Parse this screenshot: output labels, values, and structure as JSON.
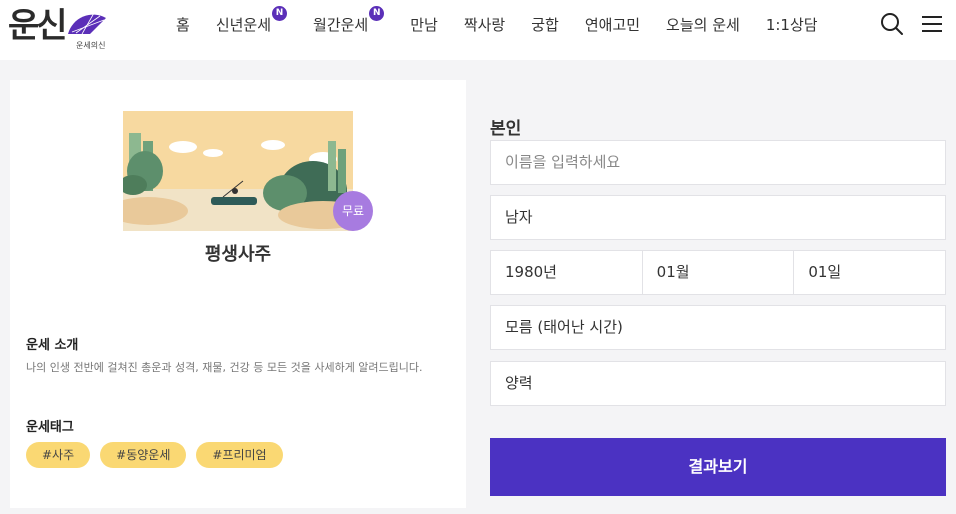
{
  "header": {
    "logo_text": "운신",
    "logo_sub": "운세의신",
    "nav": [
      {
        "label": "홈",
        "badge": ""
      },
      {
        "label": "신년운세",
        "badge": "N"
      },
      {
        "label": "월간운세",
        "badge": "N"
      },
      {
        "label": "만남",
        "badge": ""
      },
      {
        "label": "짝사랑",
        "badge": ""
      },
      {
        "label": "궁합",
        "badge": ""
      },
      {
        "label": "연애고민",
        "badge": ""
      },
      {
        "label": "오늘의 운세",
        "badge": ""
      },
      {
        "label": "1:1상담",
        "badge": ""
      }
    ],
    "icons": [
      "search-icon",
      "menu-icon"
    ]
  },
  "card": {
    "badge": "무료",
    "title": "평생사주",
    "intro_heading": "운세 소개",
    "intro_text": "나의 인생 전반에 걸쳐진 총운과 성격, 재물, 건강 등 모든 것을 사세하게 알려드립니다.",
    "tags_heading": "운세태그",
    "tags": [
      "#사주",
      "#동양운세",
      "#프리미엄"
    ]
  },
  "form": {
    "label": "본인",
    "name_placeholder": "이름을 입력하세요",
    "gender": "남자",
    "year": "1980년",
    "month": "01월",
    "day": "01일",
    "birth_time": "모름 (태어난 시간)",
    "calendar": "양력",
    "submit_label": "결과보기"
  },
  "colors": {
    "accent": "#4b32c2",
    "badge_purple": "#5b2fb8",
    "free_badge": "#a77be0",
    "tag_bg": "#fad873"
  }
}
